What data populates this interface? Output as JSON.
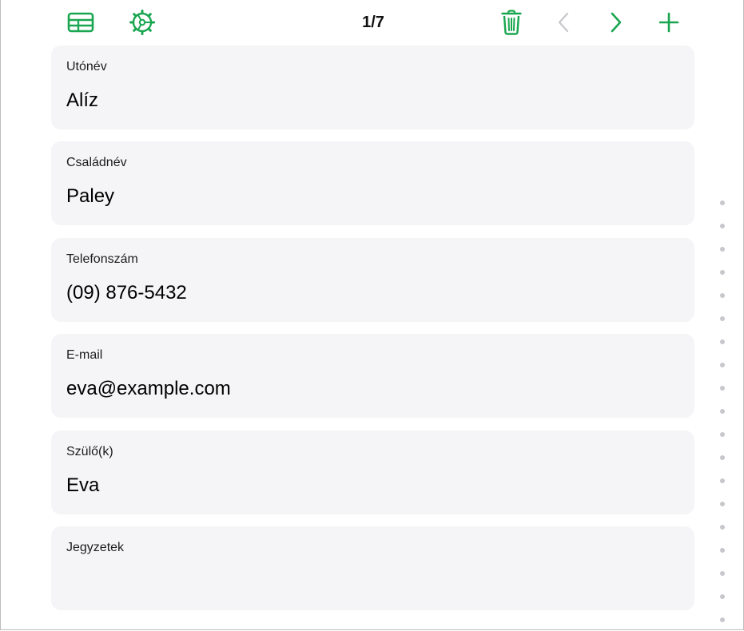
{
  "toolbar": {
    "counter": "1/7",
    "accent_color": "#1aa650",
    "disabled_color": "#c8c8cc",
    "icons": {
      "table": "table-icon",
      "settings": "gear-icon",
      "delete": "trash-icon",
      "previous": "chevron-left-icon",
      "next": "chevron-right-icon",
      "add": "plus-icon"
    }
  },
  "fields": [
    {
      "label": "Utónév",
      "value": "Alíz"
    },
    {
      "label": "Családnév",
      "value": "Paley"
    },
    {
      "label": "Telefonszám",
      "value": "(09) 876-5432"
    },
    {
      "label": "E-mail",
      "value": "eva@example.com"
    },
    {
      "label": "Szülő(k)",
      "value": "Eva"
    },
    {
      "label": "Jegyzetek",
      "value": ""
    }
  ]
}
